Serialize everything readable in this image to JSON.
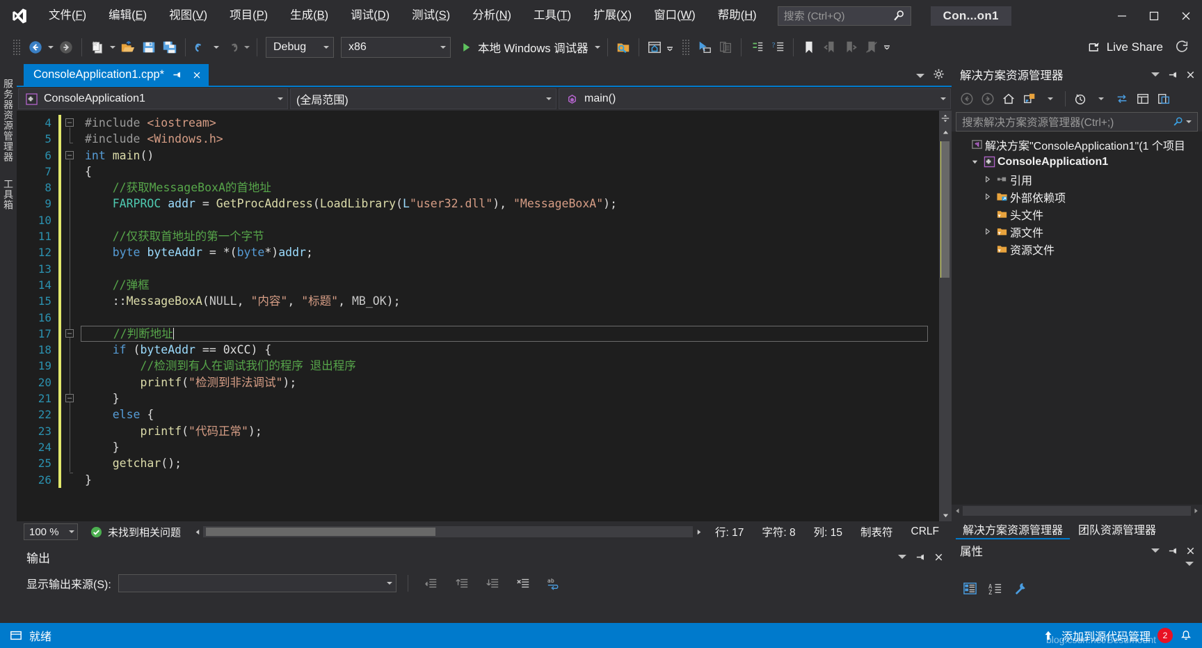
{
  "colors": {
    "accent": "#007acc",
    "chrome": "#2d2d30",
    "editor_bg": "#1e1e1e",
    "comment": "#57a64a",
    "string": "#d69d85",
    "keyword": "#569cd6",
    "type": "#4ec9b0",
    "function": "#dcdcaa",
    "variable": "#9cdcfe",
    "linenumber": "#2b91af",
    "changebar": "#e2e86b",
    "error_badge": "#e81123"
  },
  "titlebar": {
    "logo_icon": "visual-studio-logo-icon",
    "menus": [
      {
        "label": "文件(F)",
        "accel": "F"
      },
      {
        "label": "编辑(E)",
        "accel": "E"
      },
      {
        "label": "视图(V)",
        "accel": "V"
      },
      {
        "label": "项目(P)",
        "accel": "P"
      },
      {
        "label": "生成(B)",
        "accel": "B"
      },
      {
        "label": "调试(D)",
        "accel": "D"
      },
      {
        "label": "测试(S)",
        "accel": "S"
      },
      {
        "label": "分析(N)",
        "accel": "N"
      },
      {
        "label": "工具(T)",
        "accel": "T"
      },
      {
        "label": "扩展(X)",
        "accel": "X"
      },
      {
        "label": "窗口(W)",
        "accel": "W"
      },
      {
        "label": "帮助(H)",
        "accel": "H"
      }
    ],
    "quick_search": {
      "placeholder": "搜索 (Ctrl+Q)",
      "value": "",
      "icon": "search-icon"
    },
    "window_title": "Con...on1",
    "minimize_icon": "minimize-icon",
    "maximize_icon": "maximize-icon",
    "close_icon": "close-icon"
  },
  "toolbar": {
    "navigate_back_icon": "navigate-back-icon",
    "navigate_forward_icon": "navigate-forward-icon",
    "new_file_icon": "new-file-icon",
    "open_file_icon": "open-file-icon",
    "save_icon": "save-icon",
    "save_all_icon": "save-all-icon",
    "undo_icon": "undo-icon",
    "redo_icon": "redo-icon",
    "configuration": {
      "value": "Debug",
      "label": "Debug"
    },
    "platform": {
      "value": "x86",
      "label": "x86"
    },
    "run_label": "本地 Windows 调试器",
    "run_icon": "play-icon",
    "search_folder_icon": "search-folder-icon",
    "preview_window_icon": "preview-window-icon",
    "select_element_icon": "select-element-icon",
    "copy_layout_icon": "copy-layout-icon",
    "outline_icon": "outline-green-icon",
    "property_list_icon": "property-list-icon",
    "bookmark_icon": "bookmark-icon",
    "prev_bookmark_icon": "prev-bookmark-icon",
    "next_bookmark_icon": "next-bookmark-icon",
    "clear_bookmark_icon": "clear-bookmark-icon",
    "live_share": {
      "label": "Live Share",
      "icon": "live-share-icon"
    },
    "feedback_icon": "feedback-icon"
  },
  "left_rail": {
    "tabs": [
      {
        "label": "服务器资源管理器",
        "name": "server-explorer"
      },
      {
        "label": "工具箱",
        "name": "toolbox"
      }
    ]
  },
  "editor": {
    "tab": {
      "title": "ConsoleApplication1.cpp*",
      "pin_icon": "pin-icon",
      "close_icon": "close-icon"
    },
    "tab_dropdown_icon": "chevron-down-icon",
    "tab_settings_icon": "gear-icon",
    "nav": {
      "project": "ConsoleApplication1",
      "project_icon": "cpp-project-icon",
      "scope": "(全局范围)",
      "member": "main()",
      "member_icon": "method-icon"
    },
    "first_line_number": 4,
    "lines": [
      {
        "n": 4,
        "text": "#include <iostream>"
      },
      {
        "n": 5,
        "text": "#include <Windows.h>"
      },
      {
        "n": 6,
        "text": "int main()"
      },
      {
        "n": 7,
        "text": "{"
      },
      {
        "n": 8,
        "text": "    //获取MessageBoxA的首地址"
      },
      {
        "n": 9,
        "text": "    FARPROC addr = GetProcAddress(LoadLibrary(L\"user32.dll\"), \"MessageBoxA\");"
      },
      {
        "n": 10,
        "text": ""
      },
      {
        "n": 11,
        "text": "    //仅获取首地址的第一个字节"
      },
      {
        "n": 12,
        "text": "    byte byteAddr = *(byte*)addr;"
      },
      {
        "n": 13,
        "text": ""
      },
      {
        "n": 14,
        "text": "    //弹框"
      },
      {
        "n": 15,
        "text": "    ::MessageBoxA(NULL, \"内容\", \"标题\", MB_OK);"
      },
      {
        "n": 16,
        "text": ""
      },
      {
        "n": 17,
        "text": "    //判断地址"
      },
      {
        "n": 18,
        "text": "    if (byteAddr == 0xCC) {"
      },
      {
        "n": 19,
        "text": "        //检测到有人在调试我们的程序 退出程序"
      },
      {
        "n": 20,
        "text": "        printf(\"检测到非法调试\");"
      },
      {
        "n": 21,
        "text": "    }"
      },
      {
        "n": 22,
        "text": "    else {"
      },
      {
        "n": 23,
        "text": "        printf(\"代码正常\");"
      },
      {
        "n": 24,
        "text": "    }"
      },
      {
        "n": 25,
        "text": "    getchar();"
      },
      {
        "n": 26,
        "text": "}"
      }
    ],
    "current_line": 17,
    "status": {
      "zoom": "100 %",
      "issue_icon": "check-circle-icon",
      "issue_text": "未找到相关问题",
      "line_label": "行: 17",
      "char_label": "字符: 8",
      "col_label": "列: 15",
      "tab_label": "制表符",
      "eol_label": "CRLF"
    }
  },
  "output": {
    "title": "输出",
    "dropdown_icon": "chevron-down-icon",
    "pin_icon": "pin-icon",
    "close_icon": "close-icon",
    "source_label": "显示输出来源(S):",
    "source_value": "",
    "buttons": [
      {
        "name": "output-goto-source-button",
        "icon": "goto-source-icon"
      },
      {
        "name": "output-prev-message-button",
        "icon": "prev-message-icon"
      },
      {
        "name": "output-next-message-button",
        "icon": "next-message-icon"
      },
      {
        "name": "output-clear-button",
        "icon": "clear-all-icon"
      },
      {
        "name": "output-toggle-wordwrap-button",
        "icon": "word-wrap-icon"
      }
    ]
  },
  "solution_explorer": {
    "title": "解决方案资源管理器",
    "header_buttons": [
      {
        "name": "solution-explorer-dropdown-button",
        "icon": "chevron-down-icon"
      },
      {
        "name": "solution-explorer-pin-button",
        "icon": "pin-icon"
      },
      {
        "name": "solution-explorer-close-button",
        "icon": "close-icon"
      }
    ],
    "toolbar": [
      {
        "name": "se-back-button",
        "icon": "back-arrow-icon"
      },
      {
        "name": "se-forward-button",
        "icon": "forward-arrow-icon"
      },
      {
        "name": "se-home-button",
        "icon": "home-icon"
      },
      {
        "name": "se-show-all-files-button",
        "icon": "show-all-files-icon"
      },
      {
        "name": "se-pending-changes-button",
        "icon": "history-clock-icon"
      },
      {
        "name": "se-sync-button",
        "icon": "sync-arrows-icon"
      },
      {
        "name": "se-properties-button",
        "icon": "properties-window-icon"
      },
      {
        "name": "se-preview-selected-button",
        "icon": "preview-selected-icon"
      }
    ],
    "search": {
      "placeholder": "搜索解决方案资源管理器(Ctrl+;)",
      "value": "",
      "icon": "search-icon"
    },
    "tree": [
      {
        "label": "解决方案\"ConsoleApplication1\"(1 个项目",
        "indent": 0,
        "icon": "solution-icon",
        "expander": "none",
        "bold": false
      },
      {
        "label": "ConsoleApplication1",
        "indent": 1,
        "icon": "cpp-project-icon",
        "expander": "expanded",
        "bold": true
      },
      {
        "label": "引用",
        "indent": 2,
        "icon": "references-icon",
        "expander": "collapsed",
        "bold": false
      },
      {
        "label": "外部依赖项",
        "indent": 2,
        "icon": "external-deps-folder-icon",
        "expander": "collapsed",
        "bold": false
      },
      {
        "label": "头文件",
        "indent": 2,
        "icon": "filter-folder-icon",
        "expander": "none",
        "bold": false
      },
      {
        "label": "源文件",
        "indent": 2,
        "icon": "filter-folder-icon",
        "expander": "collapsed",
        "bold": false
      },
      {
        "label": "资源文件",
        "indent": 2,
        "icon": "filter-folder-icon",
        "expander": "none",
        "bold": false
      }
    ],
    "tabs": [
      {
        "label": "解决方案资源管理器",
        "active": true
      },
      {
        "label": "团队资源管理器",
        "active": false
      }
    ]
  },
  "properties": {
    "title": "属性",
    "header_buttons": [
      {
        "name": "properties-dropdown-button",
        "icon": "chevron-down-icon"
      },
      {
        "name": "properties-pin-button",
        "icon": "pin-icon"
      },
      {
        "name": "properties-close-button",
        "icon": "close-icon"
      }
    ],
    "collapse_icon": "chevron-down-icon",
    "toolbar": [
      {
        "name": "properties-categorized-button",
        "icon": "categorized-icon"
      },
      {
        "name": "properties-alphabetical-button",
        "icon": "alphabetical-sort-icon"
      },
      {
        "name": "properties-events-button",
        "icon": "events-wrench-icon"
      }
    ]
  },
  "statusbar": {
    "ready_icon": "ready-icon",
    "ready_text": "就绪",
    "source_control_text": "添加到源代码管理",
    "upload_icon": "upload-arrow-icon",
    "notifications_icon": "notifications-bell-icon",
    "error_count": "2",
    "watermark": "blog.csdn.net/Besumount"
  }
}
